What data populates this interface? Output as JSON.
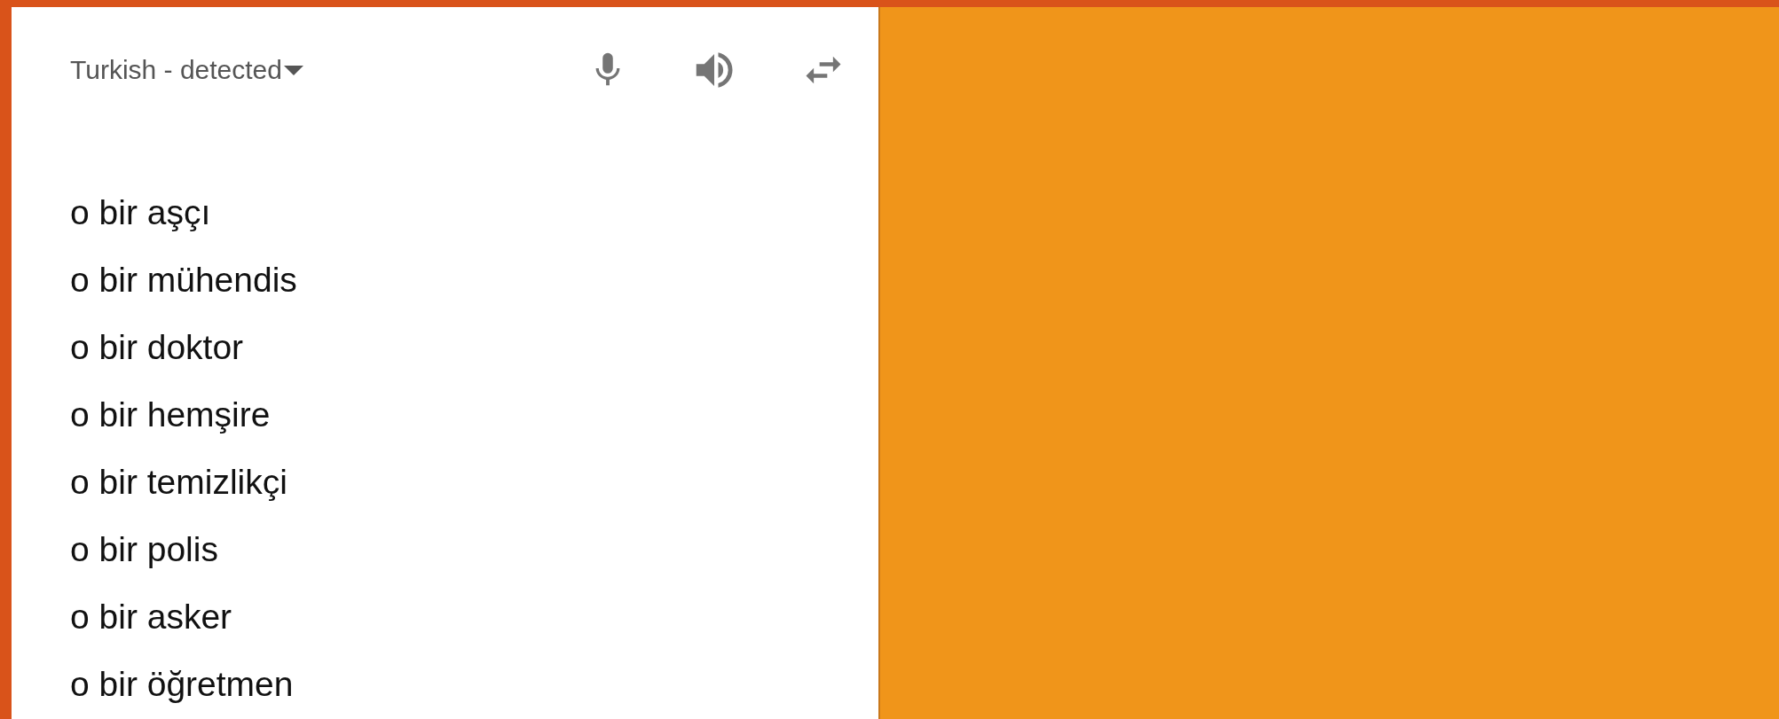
{
  "source_panel": {
    "language_label": "Turkish - detected",
    "lines": [
      "o bir aşçı",
      "o bir mühendis",
      "o bir doktor",
      "o bir hemşire",
      "o bir temizlikçi",
      "o bir polis",
      "o bir asker",
      "o bir öğretmen"
    ]
  }
}
